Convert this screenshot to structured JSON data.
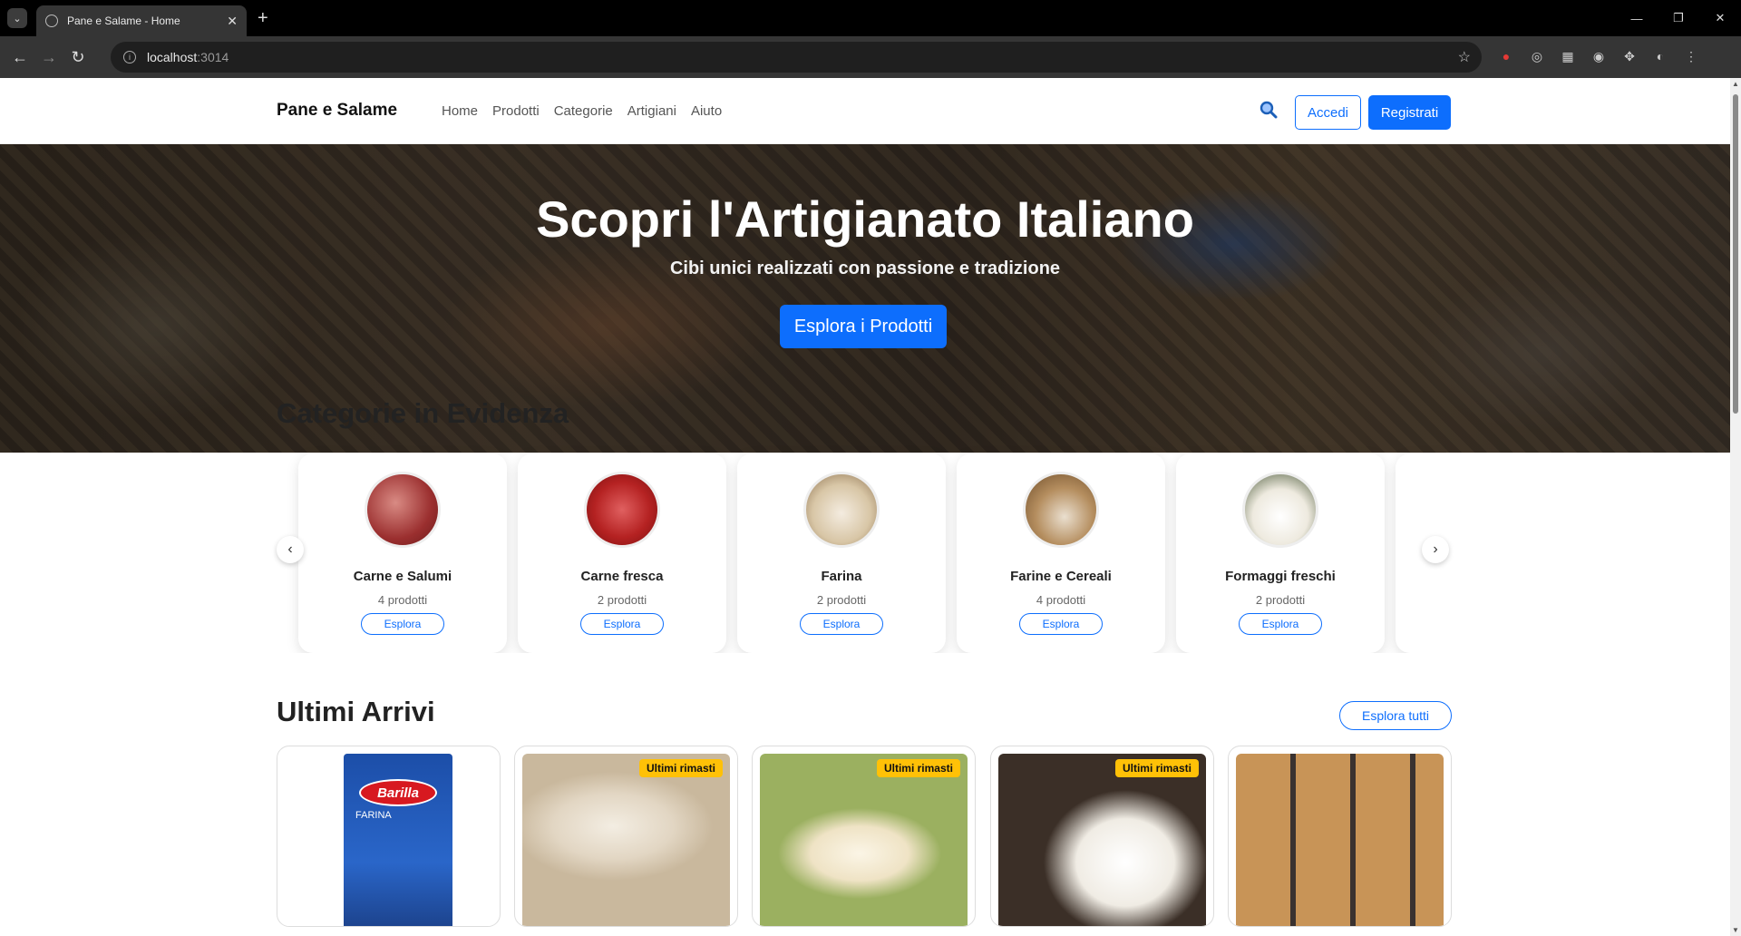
{
  "browser": {
    "tab_title": "Pane e Salame - Home",
    "url_host": "localhost",
    "url_port": ":3014"
  },
  "navbar": {
    "brand": "Pane e Salame",
    "links": [
      "Home",
      "Prodotti",
      "Categorie",
      "Artigiani",
      "Aiuto"
    ],
    "login": "Accedi",
    "register": "Registrati"
  },
  "hero": {
    "title": "Scopri l'Artigianato Italiano",
    "subtitle": "Cibi unici realizzati con passione e tradizione",
    "cta": "Esplora i Prodotti"
  },
  "categories": {
    "title": "Categorie in Evidenza",
    "items": [
      {
        "name": "Carne e Salumi",
        "count": "4 prodotti",
        "button": "Esplora"
      },
      {
        "name": "Carne fresca",
        "count": "2 prodotti",
        "button": "Esplora"
      },
      {
        "name": "Farina",
        "count": "2 prodotti",
        "button": "Esplora"
      },
      {
        "name": "Farine e Cereali",
        "count": "4 prodotti",
        "button": "Esplora"
      },
      {
        "name": "Formaggi freschi",
        "count": "2 prodotti",
        "button": "Esplora"
      }
    ]
  },
  "new_arrivals": {
    "title": "Ultimi Arrivi",
    "explore_all": "Esplora tutti",
    "badge": "Ultimi rimasti",
    "package_brand": "Barilla",
    "package_label": "FARINA"
  },
  "colors": {
    "primary": "#0d6efd",
    "badge": "#ffc107"
  }
}
